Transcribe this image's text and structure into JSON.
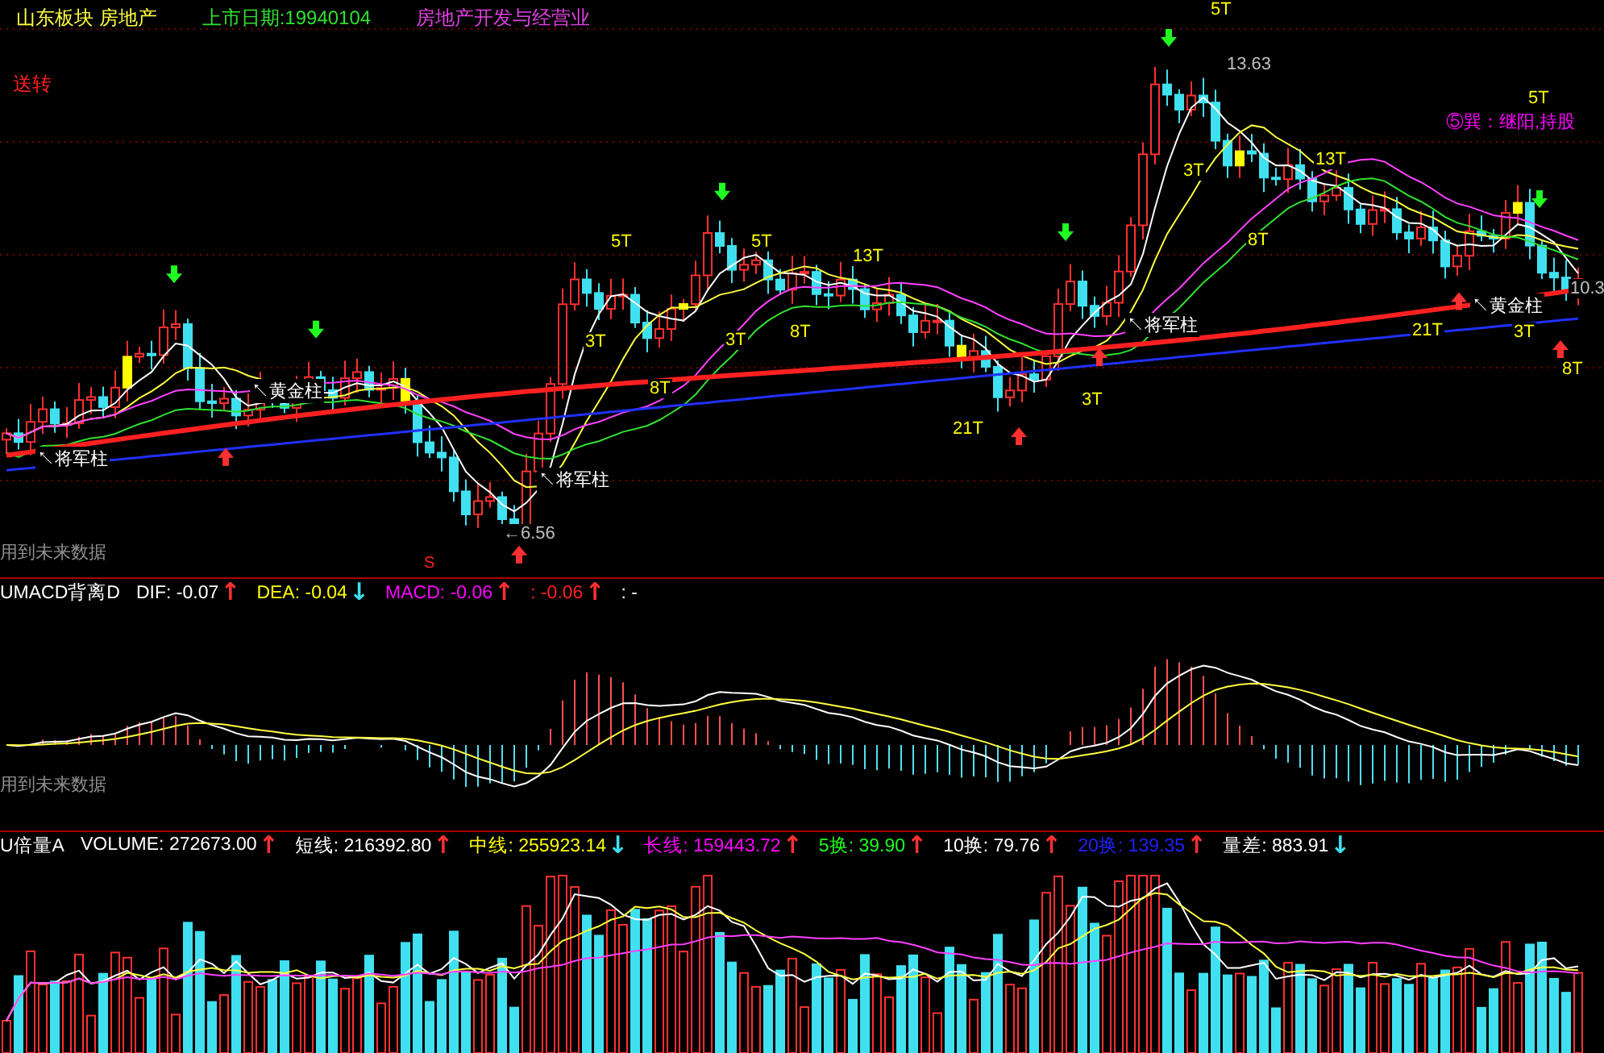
{
  "header": {
    "board": "山东板块 房地产",
    "listing_date": "上市日期:19940104",
    "business": "房地产开发与经营业"
  },
  "price_panel": {
    "note": "送转",
    "future_note": "用到未来数据",
    "marker": "S",
    "annotations": [
      {
        "text": "5T",
        "color": "#ffff00"
      },
      {
        "text": "13.63",
        "color": "#c0c0c0"
      },
      {
        "text": "5T",
        "color": "#ffff00"
      },
      {
        "text": "5T",
        "color": "#ffff00"
      },
      {
        "text": "13T",
        "color": "#ffff00"
      },
      {
        "text": "3T",
        "color": "#ffff00"
      },
      {
        "text": "8T",
        "color": "#ffff00"
      },
      {
        "text": "3T",
        "color": "#ffff00"
      },
      {
        "text": "8T",
        "color": "#ffff00"
      },
      {
        "text": "21T",
        "color": "#ffff00"
      },
      {
        "text": "3T",
        "color": "#ffff00"
      },
      {
        "text": "3T",
        "color": "#ffff00"
      },
      {
        "text": "8T",
        "color": "#ffff00"
      },
      {
        "text": "13T",
        "color": "#ffff00"
      },
      {
        "text": "21T",
        "color": "#ffff00"
      },
      {
        "text": "3T",
        "color": "#ffff00"
      },
      {
        "text": "8T",
        "color": "#ffff00"
      },
      {
        "text": "5T",
        "color": "#ffff00"
      },
      {
        "text": "⑤巽：继阳,持股",
        "color": "#ff00ff"
      },
      {
        "text": "↖将军柱",
        "color": "#ffffff"
      },
      {
        "text": "↖黄金柱",
        "color": "#ffffff"
      },
      {
        "text": "↖将军柱",
        "color": "#ffffff"
      },
      {
        "text": "↖将军柱",
        "color": "#ffffff"
      },
      {
        "text": "↖黄金柱",
        "color": "#ffffff"
      },
      {
        "text": "←6.56",
        "color": "#c0c0c0"
      },
      {
        "text": "10.3",
        "color": "#c0c0c0"
      }
    ]
  },
  "macd_panel": {
    "future_note": "用到未来数据",
    "legend": [
      {
        "text": "UMACD背离D",
        "color": "#ffffff"
      },
      {
        "text": "DIF: -0.07",
        "color": "#ffffff",
        "arrow": {
          "text": "↑",
          "color": "#ff3030"
        }
      },
      {
        "text": "DEA: -0.04",
        "color": "#ffff00",
        "arrow": {
          "text": "↓",
          "color": "#40e0f0"
        }
      },
      {
        "text": "MACD: -0.06",
        "color": "#ff00ff",
        "arrow": {
          "text": "↑",
          "color": "#ff3030"
        }
      },
      {
        "text": ": -0.06",
        "color": "#ff2020",
        "arrow": {
          "text": "↑",
          "color": "#ff3030"
        }
      },
      {
        "text": ": -",
        "color": "#ffffff"
      }
    ]
  },
  "volume_panel": {
    "legend": [
      {
        "text": "U倍量A",
        "color": "#ffffff"
      },
      {
        "text": "VOLUME: 272673.00",
        "color": "#ffffff",
        "arrow": {
          "text": "↑",
          "color": "#ff3030"
        }
      },
      {
        "text": "短线: 216392.80",
        "color": "#ffffff",
        "arrow": {
          "text": "↑",
          "color": "#ff3030"
        }
      },
      {
        "text": "中线: 255923.14",
        "color": "#ffff00",
        "arrow": {
          "text": "↓",
          "color": "#40e0f0"
        }
      },
      {
        "text": "长线: 159443.72",
        "color": "#ff00ff",
        "arrow": {
          "text": "↑",
          "color": "#ff3030"
        }
      },
      {
        "text": "5换: 39.90",
        "color": "#20ff20",
        "arrow": {
          "text": "↑",
          "color": "#ff3030"
        }
      },
      {
        "text": "10换: 79.76",
        "color": "#ffffff",
        "arrow": {
          "text": "↑",
          "color": "#ff3030"
        }
      },
      {
        "text": "20换: 139.35",
        "color": "#2020ff",
        "arrow": {
          "text": "↑",
          "color": "#ff3030"
        }
      },
      {
        "text": "量差: 883.91",
        "color": "#ffffff",
        "arrow": {
          "text": "↓",
          "color": "#40e0f0"
        }
      }
    ]
  }
}
